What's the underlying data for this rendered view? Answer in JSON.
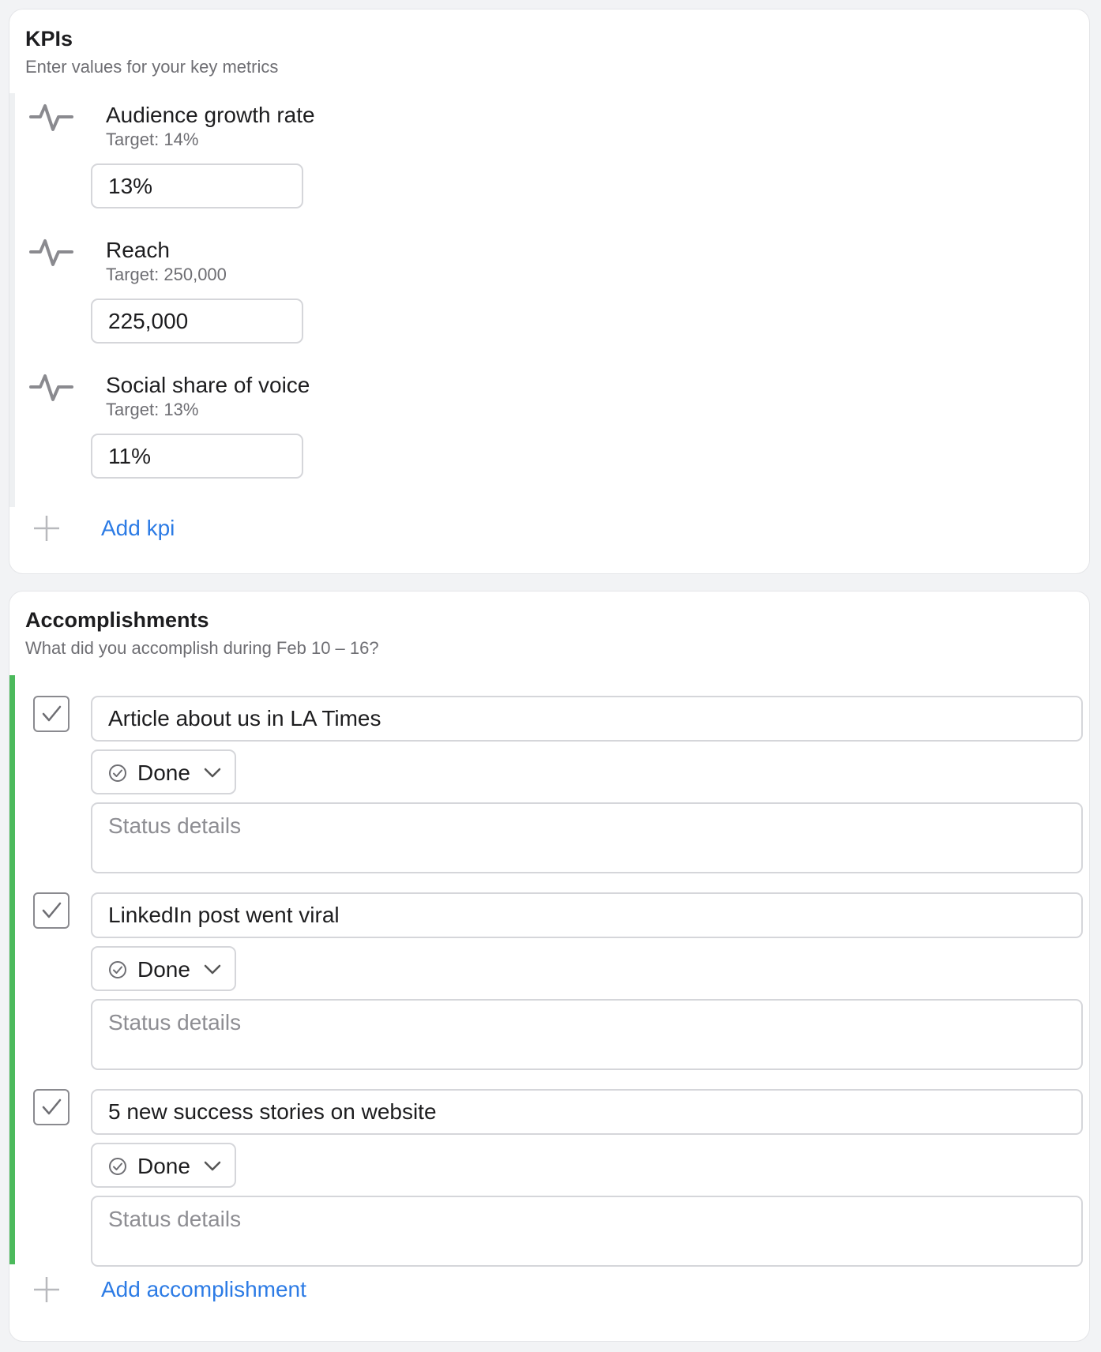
{
  "kpis": {
    "title": "KPIs",
    "subtitle": "Enter values for your key metrics",
    "items": [
      {
        "icon": "activity-pulse-icon",
        "name": "Audience growth rate",
        "target": "Target: 14%",
        "value": "13%"
      },
      {
        "icon": "activity-pulse-icon",
        "name": "Reach",
        "target": "Target: 250,000",
        "value": "225,000"
      },
      {
        "icon": "activity-pulse-icon",
        "name": "Social share of voice",
        "target": "Target: 13%",
        "value": "11%"
      }
    ],
    "add_label": "Add kpi"
  },
  "accomplishments": {
    "title": "Accomplishments",
    "subtitle": "What did you accomplish during Feb 10 – 16?",
    "items": [
      {
        "checked": true,
        "title": "Article about us in LA Times",
        "status": "Done",
        "details_placeholder": "Status details"
      },
      {
        "checked": true,
        "title": "LinkedIn post went viral",
        "status": "Done",
        "details_placeholder": "Status details"
      },
      {
        "checked": true,
        "title": "5 new success stories on website",
        "status": "Done",
        "details_placeholder": "Status details"
      }
    ],
    "add_label": "Add accomplishment"
  },
  "colors": {
    "accent": "#2c7be5",
    "done_bar": "#4cba5c",
    "border": "#d5d6da",
    "muted_text": "#6e6e73",
    "icon_gray": "#8a8a8f"
  }
}
